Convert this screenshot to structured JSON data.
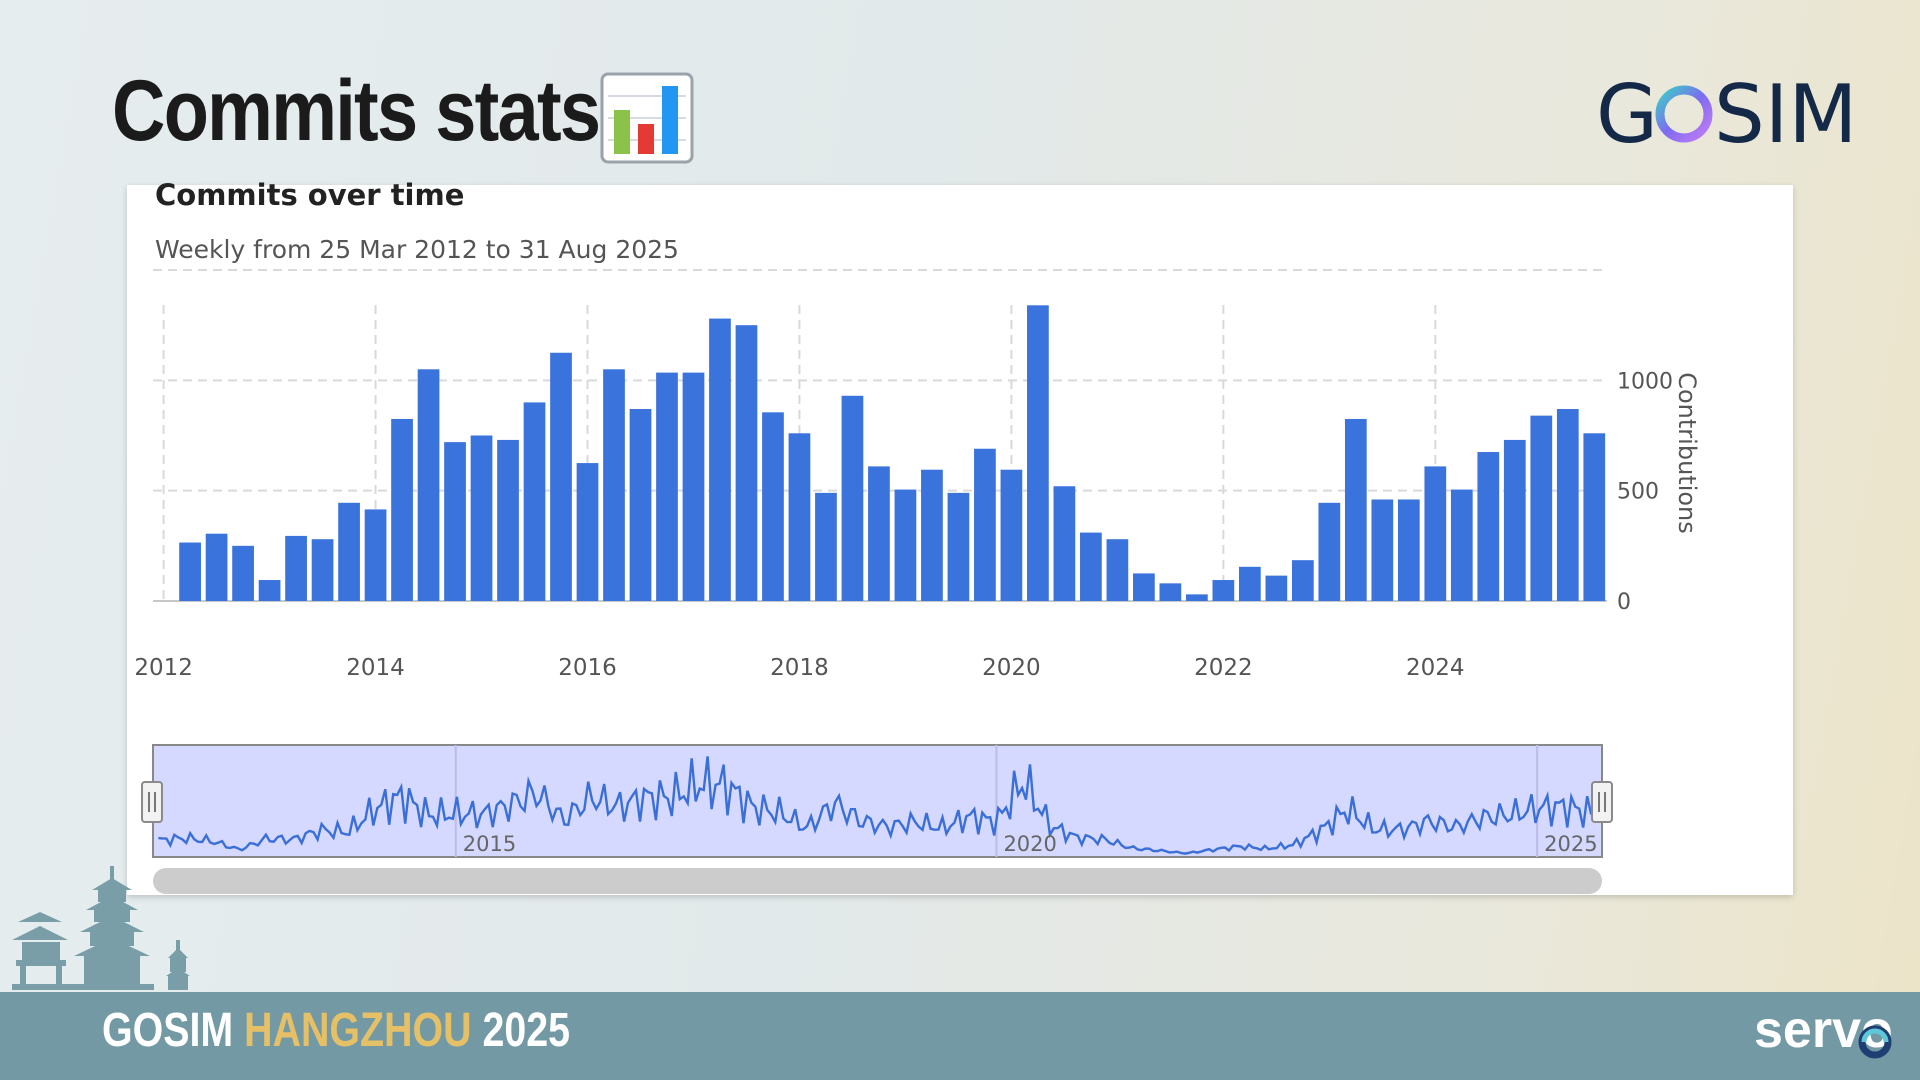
{
  "slide": {
    "title": "Commits stats",
    "title_emoji": "bar-chart-emoji",
    "logo_text": "GOSIM",
    "footer": {
      "org": "GOSIM",
      "city": "HANGZHOU",
      "year": "2025"
    },
    "brand": "servo"
  },
  "colors": {
    "bar": "#3a73db",
    "navigator_fill": "#d5d8ff",
    "footer_bg": "#739aa4",
    "footer_city": "#e6c067",
    "text_dark": "#1b1b1b"
  },
  "chart_data": {
    "type": "bar",
    "title": "Commits over time",
    "subtitle": "Weekly from 25 Mar 2012 to 31 Aug 2025",
    "ylabel": "Contributions",
    "ylim": [
      0,
      1500
    ],
    "yticks": [
      0,
      500,
      1000
    ],
    "grid": true,
    "x_tick_labels": [
      "2012",
      "2014",
      "2016",
      "2018",
      "2020",
      "2022",
      "2024"
    ],
    "x_tick_positions": [
      2012,
      2014,
      2016,
      2018,
      2020,
      2022,
      2024
    ],
    "x": [
      2012.25,
      2012.5,
      2012.75,
      2013.0,
      2013.25,
      2013.5,
      2013.75,
      2014.0,
      2014.25,
      2014.5,
      2014.75,
      2015.0,
      2015.25,
      2015.5,
      2015.75,
      2016.0,
      2016.25,
      2016.5,
      2016.75,
      2017.0,
      2017.25,
      2017.5,
      2017.75,
      2018.0,
      2018.25,
      2018.5,
      2018.75,
      2019.0,
      2019.25,
      2019.5,
      2019.75,
      2020.0,
      2020.25,
      2020.5,
      2020.75,
      2021.0,
      2021.25,
      2021.5,
      2021.75,
      2022.0,
      2022.25,
      2022.5,
      2022.75,
      2023.0,
      2023.25,
      2023.5,
      2023.75,
      2024.0,
      2024.25,
      2024.5,
      2024.75,
      2025.0,
      2025.25,
      2025.5
    ],
    "values": [
      265,
      305,
      250,
      95,
      295,
      280,
      445,
      415,
      825,
      1050,
      720,
      750,
      730,
      900,
      1125,
      625,
      1050,
      870,
      1035,
      1035,
      1280,
      1250,
      855,
      760,
      490,
      930,
      610,
      505,
      595,
      490,
      690,
      595,
      1340,
      520,
      310,
      280,
      125,
      80,
      30,
      95,
      155,
      115,
      185,
      445,
      825,
      460,
      460,
      610,
      505,
      675,
      730,
      840,
      870,
      760
    ],
    "navigator": {
      "labels": [
        "2015",
        "2020",
        "2025"
      ],
      "label_positions": [
        2015,
        2020,
        2025
      ]
    }
  }
}
